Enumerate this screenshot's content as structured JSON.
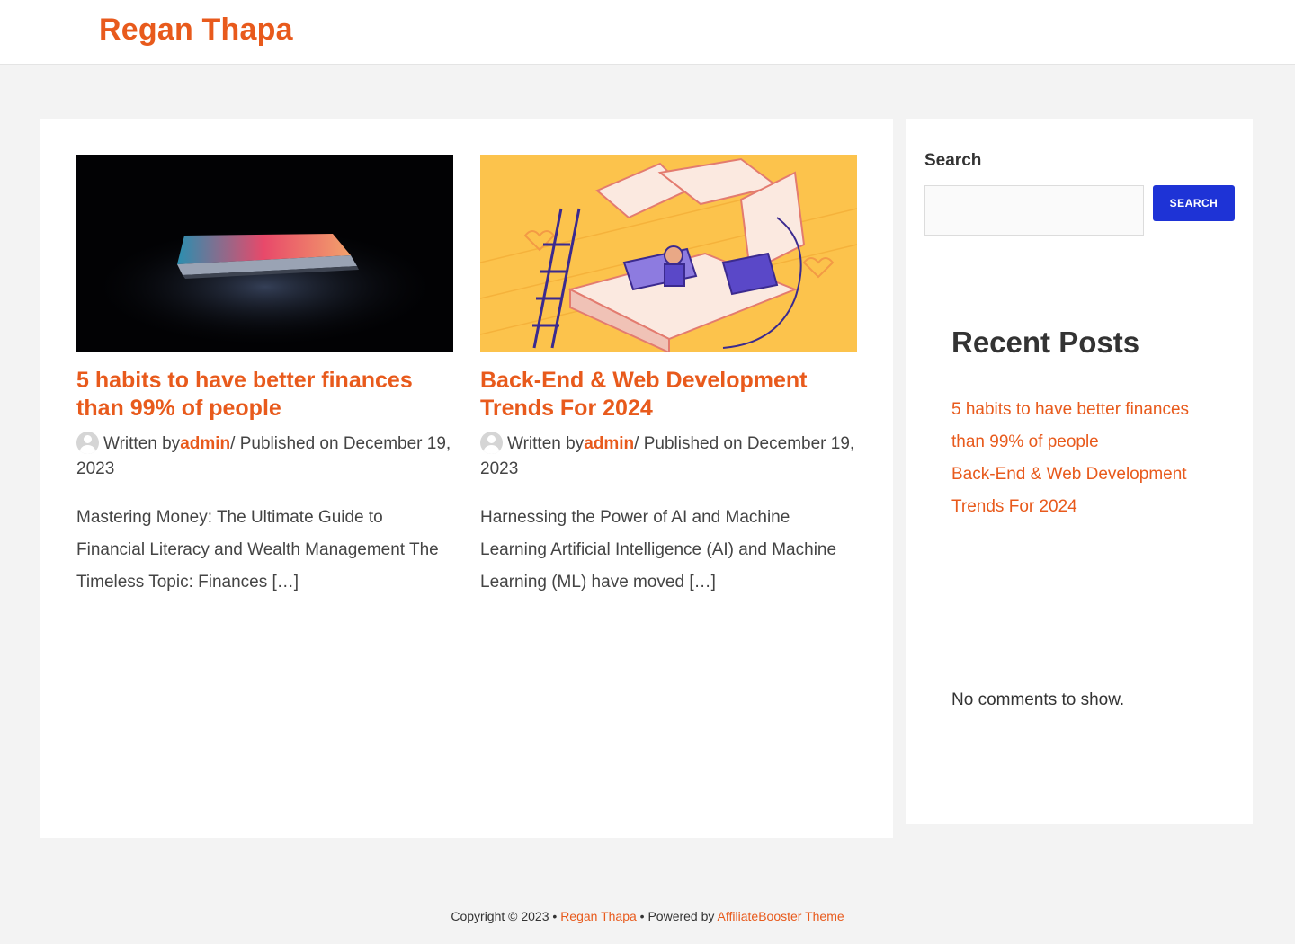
{
  "header": {
    "site_title": "Regan Thapa"
  },
  "posts": [
    {
      "title": "5 habits to have better finances than 99% of people",
      "written_by": "Written by",
      "author": "admin",
      "published": "/ Published on December 19, 2023",
      "excerpt": "Mastering Money: The Ultimate Guide to Financial Literacy and Wealth Management The Timeless Topic: Finances […]"
    },
    {
      "title": "Back-End & Web Development Trends For 2024",
      "written_by": "Written by",
      "author": "admin",
      "published": "/ Published on December 19, 2023",
      "excerpt": "Harnessing the Power of AI and Machine Learning Artificial Intelligence (AI) and Machine Learning (ML) have moved […]"
    }
  ],
  "sidebar": {
    "search_label": "Search",
    "search_placeholder": "",
    "search_button": "SEARCH",
    "recent_posts_title": "Recent Posts",
    "recent_posts": [
      "5 habits to have better finances than 99% of people",
      "Back-End & Web Development Trends For 2024"
    ],
    "no_comments": "No comments to show."
  },
  "footer": {
    "copyright": "Copyright © 2023 •",
    "site_link": "Regan Thapa",
    "powered_by": "• Powered by",
    "theme_link": "AffiliateBooster Theme"
  },
  "colors": {
    "accent": "#e85a1c",
    "button": "#1e33d6",
    "background": "#f3f3f3"
  }
}
